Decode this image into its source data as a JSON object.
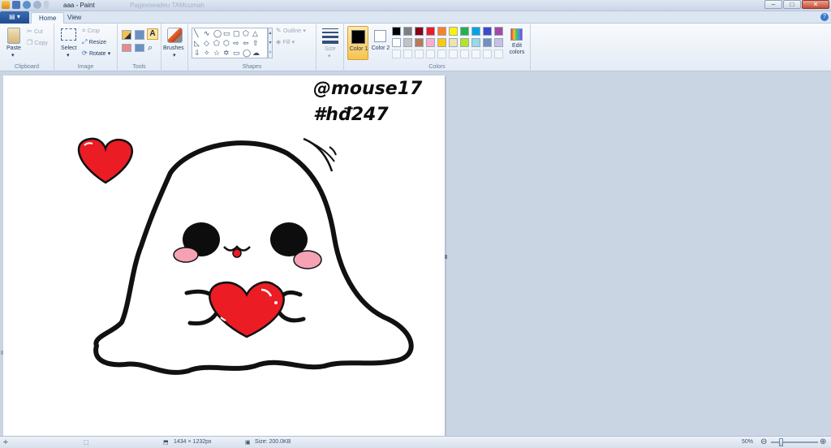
{
  "window": {
    "title": "aaa - Paint",
    "title_faint": "Pagevoeadeu TAMcumah",
    "buttons": {
      "minimize": "–",
      "maximize": "□",
      "close": "✕"
    }
  },
  "tabs": {
    "file": "▤ ▾",
    "home": "Home",
    "view": "View",
    "help": "?"
  },
  "ribbon": {
    "clipboard": {
      "label": "Clipboard",
      "paste": "Paste",
      "cut": "Cut",
      "copy": "Copy"
    },
    "image": {
      "label": "Image",
      "select": "Select",
      "crop": "Crop",
      "resize": "Resize",
      "rotate": "Rotate"
    },
    "tools": {
      "label": "Tools",
      "text_tool": "A"
    },
    "brushes": {
      "label": "Brushes"
    },
    "shapes": {
      "label": "Shapes",
      "outline": "Outline",
      "fill": "Fill"
    },
    "size": {
      "label": "Size"
    },
    "colors": {
      "label": "Colors",
      "color1": "Color 1",
      "color2": "Color 2",
      "edit": "Edit colors",
      "color1_value": "#000000",
      "color2_value": "#ffffff",
      "palette_row1": [
        "#000000",
        "#7f7f7f",
        "#880015",
        "#ed1c24",
        "#ff7f27",
        "#fff200",
        "#22b14c",
        "#00a2e8",
        "#3f48cc",
        "#a349a4"
      ],
      "palette_row2": [
        "#ffffff",
        "#c3c3c3",
        "#b97a57",
        "#ffaec9",
        "#ffc90e",
        "#efe4b0",
        "#b5e61d",
        "#99d9ea",
        "#7092be",
        "#c8bfe7"
      ]
    }
  },
  "canvas": {
    "handle_line1": "@mouse17",
    "handle_line2": "#hđ247"
  },
  "status": {
    "dimensions": "1434 × 1232px",
    "size": "Size: 200.0KB",
    "zoom": "50%"
  }
}
